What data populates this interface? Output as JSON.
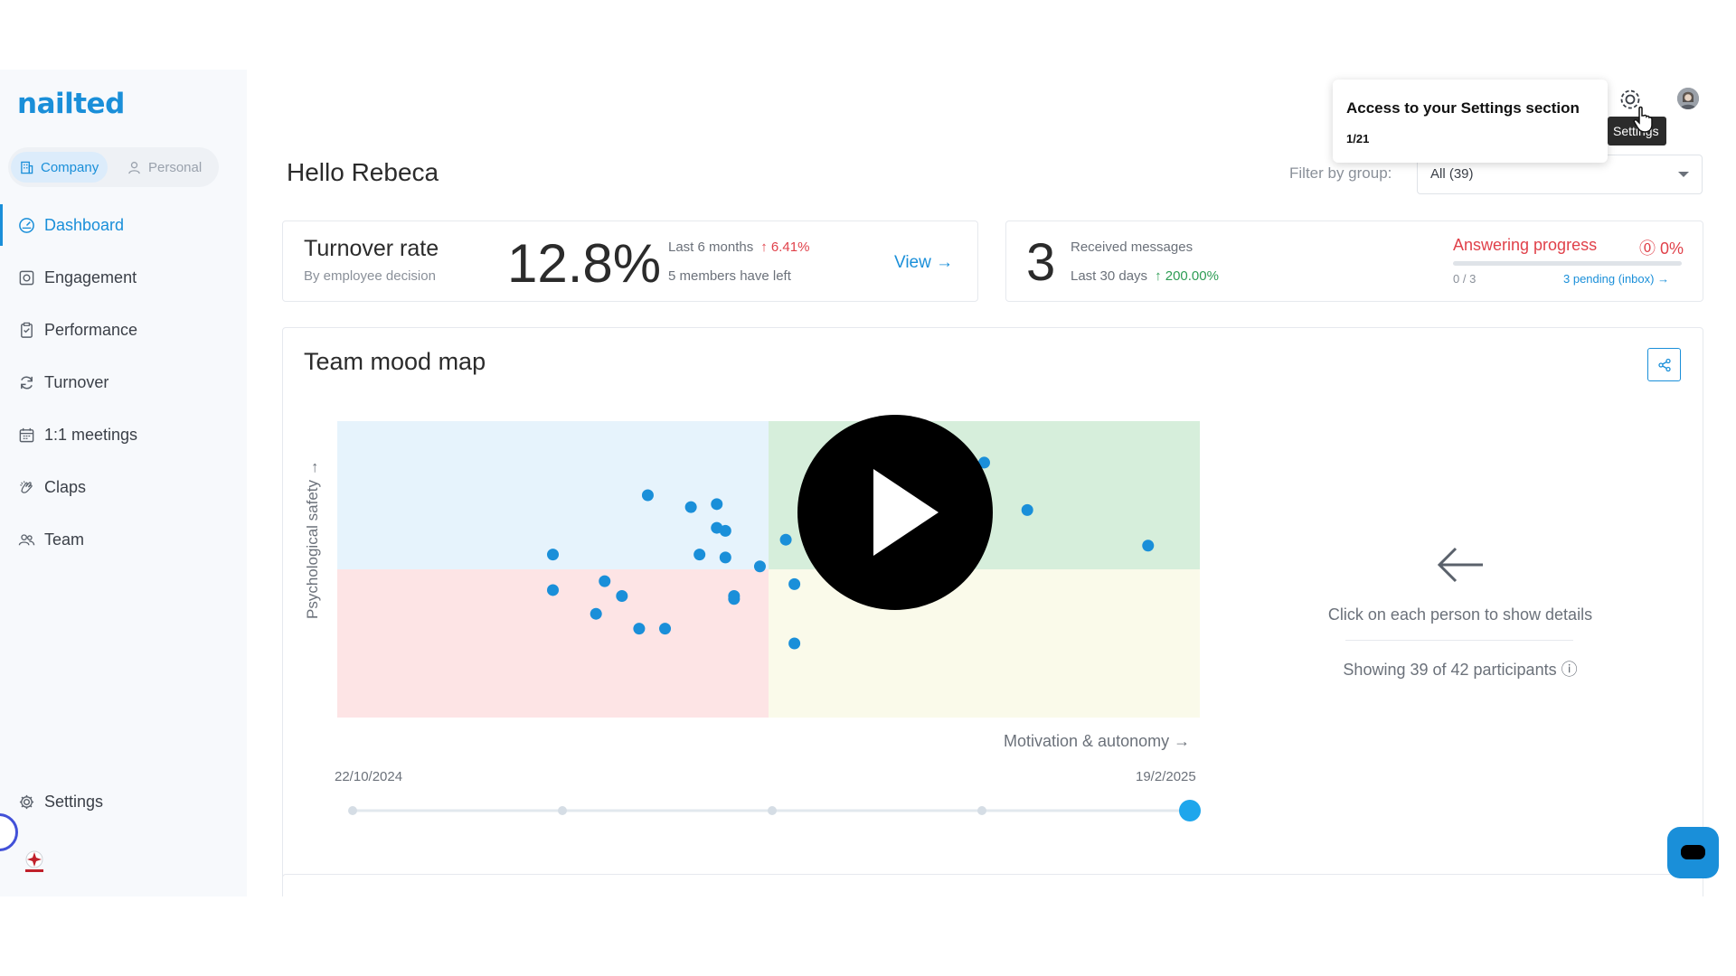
{
  "brand": "nailted",
  "mode_switch": {
    "company": "Company",
    "personal": "Personal"
  },
  "nav": [
    {
      "label": "Dashboard",
      "icon": "dashboard-icon",
      "active": true
    },
    {
      "label": "Engagement",
      "icon": "engagement-icon"
    },
    {
      "label": "Performance",
      "icon": "performance-icon"
    },
    {
      "label": "Turnover",
      "icon": "turnover-icon"
    },
    {
      "label": "1:1 meetings",
      "icon": "calendar-icon"
    },
    {
      "label": "Claps",
      "icon": "claps-icon"
    },
    {
      "label": "Team",
      "icon": "team-icon"
    }
  ],
  "settings_label": "Settings",
  "header": {
    "greeting": "Hello Rebeca",
    "filter_label": "Filter by group:",
    "filter_value": "All (39)"
  },
  "turnover_card": {
    "title": "Turnover rate",
    "subtitle": "By employee decision",
    "value": "12.8%",
    "period": "Last 6 months",
    "change": "↑ 6.41%",
    "members_left": "5 members have left",
    "view": "View →"
  },
  "messages_card": {
    "count": "3",
    "label": "Received messages",
    "period": "Last 30 days",
    "change": "↑ 200.00%",
    "progress_title": "Answering progress",
    "progress_pct": "⓪ 0%",
    "progress_fraction": "0 / 3",
    "pending_link": "3 pending (inbox) →",
    "progress_value": 0
  },
  "mood_map": {
    "title": "Team mood map",
    "y_label": "Psychological safety →",
    "x_label": "Motivation & autonomy →",
    "date_start": "22/10/2024",
    "date_end": "19/2/2025",
    "quadrant_colors": [
      "#e6f3fc",
      "#d6eedb",
      "#fde4e5",
      "#fafaea"
    ],
    "point_color": "#1a8fd9",
    "points": [
      {
        "x": 0.25,
        "y": 0.55
      },
      {
        "x": 0.25,
        "y": 0.43
      },
      {
        "x": 0.31,
        "y": 0.46
      },
      {
        "x": 0.3,
        "y": 0.35
      },
      {
        "x": 0.33,
        "y": 0.41
      },
      {
        "x": 0.35,
        "y": 0.3
      },
      {
        "x": 0.38,
        "y": 0.3
      },
      {
        "x": 0.36,
        "y": 0.75
      },
      {
        "x": 0.41,
        "y": 0.71
      },
      {
        "x": 0.44,
        "y": 0.72
      },
      {
        "x": 0.44,
        "y": 0.64
      },
      {
        "x": 0.45,
        "y": 0.63
      },
      {
        "x": 0.42,
        "y": 0.55
      },
      {
        "x": 0.45,
        "y": 0.54
      },
      {
        "x": 0.46,
        "y": 0.41
      },
      {
        "x": 0.46,
        "y": 0.4
      },
      {
        "x": 0.49,
        "y": 0.51
      },
      {
        "x": 0.52,
        "y": 0.6
      },
      {
        "x": 0.53,
        "y": 0.45
      },
      {
        "x": 0.53,
        "y": 0.25
      },
      {
        "x": 0.75,
        "y": 0.86
      },
      {
        "x": 0.8,
        "y": 0.7
      },
      {
        "x": 0.94,
        "y": 0.58
      }
    ],
    "timeline_steps": 5,
    "timeline_selected": 4,
    "details_hint": "Click on each person to show details",
    "participants": "Showing 39 of 42 participants ⓘ"
  },
  "tour": {
    "title": "Access to your Settings section",
    "step": "1/21",
    "gear_tooltip": "Settings"
  }
}
